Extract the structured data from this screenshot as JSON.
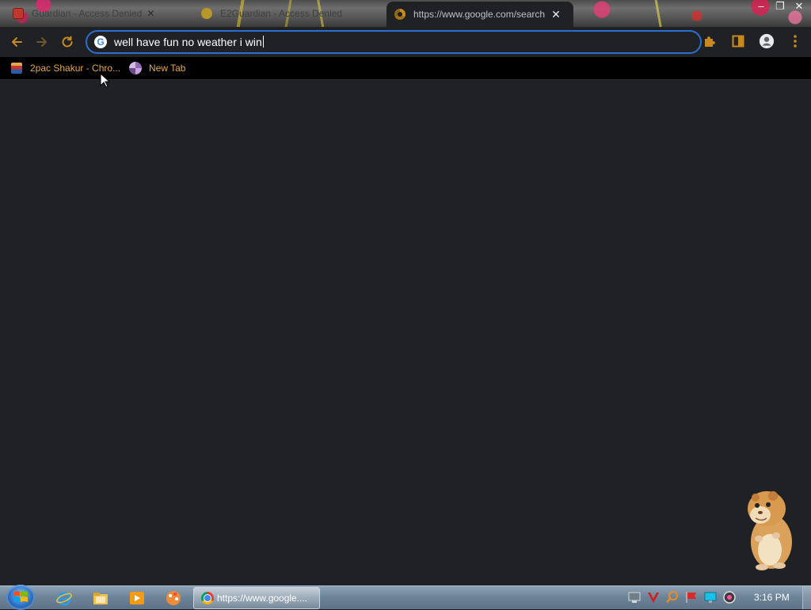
{
  "tabs": [
    {
      "label": "Guardian - Access Denied",
      "favicon": "red-page-icon",
      "active": false
    },
    {
      "label": "E2Guardian - Access Denied",
      "favicon": "yellow-circle-icon",
      "active": false
    },
    {
      "label": "https://www.google.com/search",
      "favicon": "chrome-icon",
      "active": true
    }
  ],
  "window_controls": {
    "minimize": "–",
    "maximize": "❐",
    "close": "✕"
  },
  "toolbar": {
    "omnibox_value": "well have fun no weather i win",
    "google_icon_letter": "G"
  },
  "bookmarks": [
    {
      "label": "2pac Shakur - Chro...",
      "icon": "bookmark-favicon"
    },
    {
      "label": "New Tab",
      "icon": "globe-icon"
    }
  ],
  "taskbar": {
    "active_window_label": "https://www.google....",
    "clock": "3:16 PM"
  },
  "colors": {
    "content_bg": "#202124",
    "omnibox_border": "#2a6fd0",
    "bookmark_text": "#e0a94a",
    "icon_gold": "#c68a1f"
  }
}
